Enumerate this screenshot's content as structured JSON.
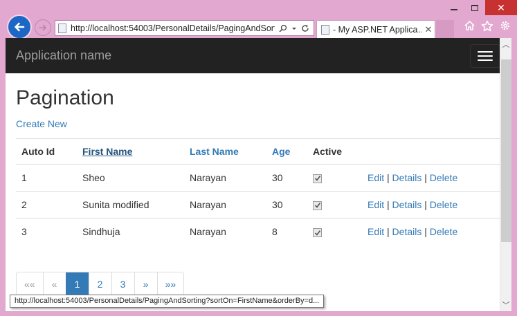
{
  "browser": {
    "address": "http://localhost:54003/PersonalDetails/PagingAndSortir",
    "tab_title": "- My ASP.NET Applica…",
    "status_url": "http://localhost:54003/PersonalDetails/PagingAndSorting?sortOn=FirstName&orderBy=d...",
    "colors": {
      "frame": "#e2a8cf",
      "close": "#c7312f",
      "back": "#1d67c4"
    },
    "icons": [
      "back-arrow-icon",
      "forward-arrow-icon",
      "search-icon",
      "dropdown-icon",
      "refresh-icon",
      "home-icon",
      "favorites-star-icon",
      "settings-gear-icon"
    ]
  },
  "navbar": {
    "brand": "Application name"
  },
  "page": {
    "title": "Pagination",
    "create_link": "Create New"
  },
  "table": {
    "headers": [
      "Auto Id",
      "First Name",
      "Last Name",
      "Age",
      "Active"
    ],
    "rows": [
      {
        "id": "1",
        "first": "Sheo",
        "last": "Narayan",
        "age": "30",
        "active": true
      },
      {
        "id": "2",
        "first": "Sunita modified",
        "last": "Narayan",
        "age": "30",
        "active": true
      },
      {
        "id": "3",
        "first": "Sindhuja",
        "last": "Narayan",
        "age": "8",
        "active": true
      }
    ],
    "actions": {
      "edit": "Edit",
      "details": "Details",
      "delete": "Delete",
      "sep": "|"
    }
  },
  "pager": {
    "first": "««",
    "prev": "«",
    "pages": [
      "1",
      "2",
      "3"
    ],
    "current": "1",
    "next": "»",
    "last": "»»"
  },
  "colors": {
    "link": "#337ab7",
    "navbar": "#222222",
    "active_page": "#337ab7"
  }
}
